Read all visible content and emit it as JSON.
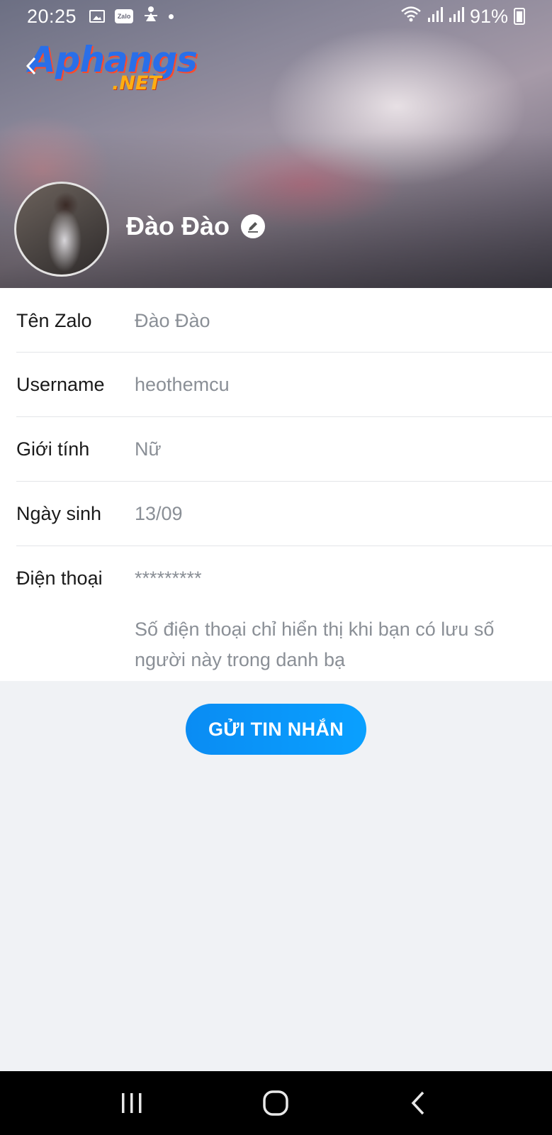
{
  "status_bar": {
    "time": "20:25",
    "battery": "91%",
    "icons": [
      "gallery-icon",
      "zalo-icon",
      "game-icon",
      "dot-icon",
      "wifi-icon",
      "signal-icon",
      "signal-icon",
      "battery-charging-icon"
    ]
  },
  "watermark": {
    "main": "Aphangs",
    "sub": ".NET"
  },
  "profile": {
    "name": "Đào Đào"
  },
  "info_rows": [
    {
      "label": "Tên Zalo",
      "value": "Đào Đào"
    },
    {
      "label": "Username",
      "value": "heothemcu"
    },
    {
      "label": "Giới tính",
      "value": "Nữ"
    },
    {
      "label": "Ngày sinh",
      "value": "13/09"
    },
    {
      "label": "Điện thoại",
      "value": "*********"
    }
  ],
  "phone_note": "Số điện thoại chỉ hiển thị khi bạn có lưu số người này trong danh bạ",
  "actions": {
    "send_message": "GỬI TIN NHẮN"
  },
  "colors": {
    "accent": "#0a8cf3",
    "page_bg": "#f0f2f5",
    "value_text": "#8a8f96"
  }
}
